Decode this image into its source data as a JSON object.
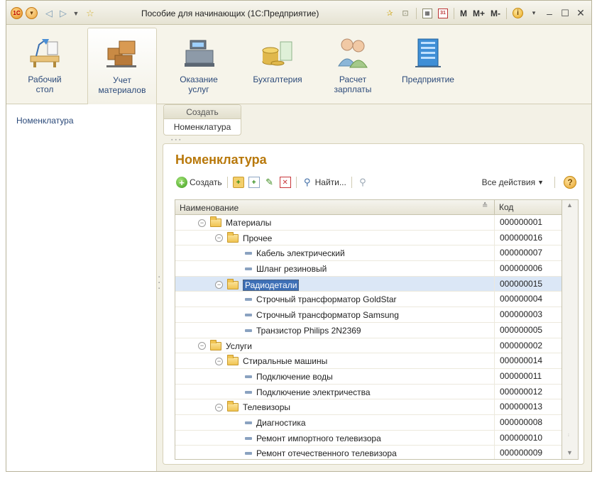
{
  "window": {
    "title": "Пособие для начинающих (1С:Предприятие)",
    "logo_text": "1С",
    "toolbar_right": {
      "m_label": "M",
      "m_plus_label": "M+",
      "m_minus_label": "M-",
      "calendar_text": "31"
    }
  },
  "sections": [
    {
      "label": "Рабочий\nстол",
      "icon": "desk-lamp-icon",
      "active": false
    },
    {
      "label": "Учет\nматериалов",
      "icon": "boxes-icon",
      "active": true
    },
    {
      "label": "Оказание\nуслуг",
      "icon": "cash-register-icon",
      "active": false
    },
    {
      "label": "Бухгалтерия",
      "icon": "coins-icon",
      "active": false
    },
    {
      "label": "Расчет\nзарплаты",
      "icon": "people-icon",
      "active": false
    },
    {
      "label": "Предприятие",
      "icon": "building-icon",
      "active": false
    }
  ],
  "left_nav": {
    "items": [
      "Номенклатура"
    ]
  },
  "create_panel": {
    "header": "Создать",
    "items": [
      "Номенклатура"
    ]
  },
  "content": {
    "title": "Номенклатура",
    "toolbar": {
      "create_label": "Создать",
      "find_label": "Найти...",
      "all_actions_label": "Все действия",
      "help_label": "?"
    },
    "table": {
      "columns": [
        "Наименование",
        "Код"
      ],
      "rows": [
        {
          "name": "Материалы",
          "code": "000000001",
          "level": 0,
          "type": "folder",
          "expanded": true
        },
        {
          "name": "Прочее",
          "code": "000000016",
          "level": 1,
          "type": "folder",
          "expanded": true
        },
        {
          "name": "Кабель электрический",
          "code": "000000007",
          "level": 2,
          "type": "item"
        },
        {
          "name": "Шланг резиновый",
          "code": "000000006",
          "level": 2,
          "type": "item"
        },
        {
          "name": "Радиодетали",
          "code": "000000015",
          "level": 1,
          "type": "folder",
          "expanded": true,
          "selected": true
        },
        {
          "name": "Строчный трансформатор GoldStar",
          "code": "000000004",
          "level": 2,
          "type": "item"
        },
        {
          "name": "Строчный трансформатор Samsung",
          "code": "000000003",
          "level": 2,
          "type": "item"
        },
        {
          "name": "Транзистор Philips 2N2369",
          "code": "000000005",
          "level": 2,
          "type": "item"
        },
        {
          "name": "Услуги",
          "code": "000000002",
          "level": 0,
          "type": "folder",
          "expanded": true
        },
        {
          "name": "Стиральные машины",
          "code": "000000014",
          "level": 1,
          "type": "folder",
          "expanded": true
        },
        {
          "name": "Подключение воды",
          "code": "000000011",
          "level": 2,
          "type": "item"
        },
        {
          "name": "Подключение электричества",
          "code": "000000012",
          "level": 2,
          "type": "item"
        },
        {
          "name": "Телевизоры",
          "code": "000000013",
          "level": 1,
          "type": "folder",
          "expanded": true
        },
        {
          "name": "Диагностика",
          "code": "000000008",
          "level": 2,
          "type": "item"
        },
        {
          "name": "Ремонт импортного телевизора",
          "code": "000000010",
          "level": 2,
          "type": "item"
        },
        {
          "name": "Ремонт отечественного телевизора",
          "code": "000000009",
          "level": 2,
          "type": "item"
        }
      ]
    }
  }
}
